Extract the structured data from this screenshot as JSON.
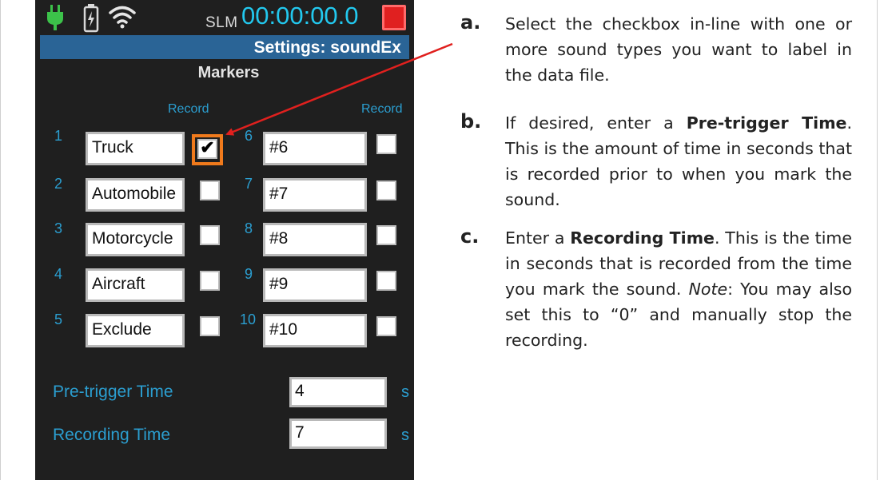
{
  "status": {
    "slm_label": "SLM",
    "timer": "00:00:00.0",
    "icons": [
      "plug-icon",
      "battery-icon",
      "wifi-icon",
      "stop-record-icon"
    ]
  },
  "title_bar": {
    "text": "Settings: soundEx"
  },
  "screen_title": "Markers",
  "column_header": "Record",
  "markers": [
    {
      "num": "1",
      "name": "Truck",
      "record": true
    },
    {
      "num": "2",
      "name": "Automobile",
      "record": false
    },
    {
      "num": "3",
      "name": "Motorcycle",
      "record": false
    },
    {
      "num": "4",
      "name": "Aircraft",
      "record": false
    },
    {
      "num": "5",
      "name": "Exclude",
      "record": false
    },
    {
      "num": "6",
      "name": "#6",
      "record": false
    },
    {
      "num": "7",
      "name": "#7",
      "record": false
    },
    {
      "num": "8",
      "name": "#8",
      "record": false
    },
    {
      "num": "9",
      "name": "#9",
      "record": false
    },
    {
      "num": "10",
      "name": "#10",
      "record": false
    }
  ],
  "pretrigger": {
    "label": "Pre-trigger Time",
    "value": "4",
    "unit": "s"
  },
  "recording": {
    "label": "Recording Time",
    "value": "7",
    "unit": "s"
  },
  "instructions": {
    "a": {
      "letter": "a.",
      "text": "Select the checkbox in-line with one or more sound types you want to label in the data file."
    },
    "b": {
      "letter": "b.",
      "pre": "If desired, enter a ",
      "bold": "Pre-trigger Time",
      "post": ". This is the amount of time in seconds that is recorded prior to when you mark the sound."
    },
    "c": {
      "letter": "c.",
      "pre": "Enter a ",
      "bold": "Recording Time",
      "post": ". This is the time in seconds that is recorded from the time you mark the sound. ",
      "note_label": "Note",
      "note_text": ": You may also set this to “0” and manually stop the recording."
    }
  },
  "colors": {
    "accent": "#2b9ed0",
    "timer": "#22c8ee",
    "title_bar": "#2a6496",
    "highlight": "#f07a1c",
    "arrow": "#e0201e",
    "stop": "#e02020"
  }
}
